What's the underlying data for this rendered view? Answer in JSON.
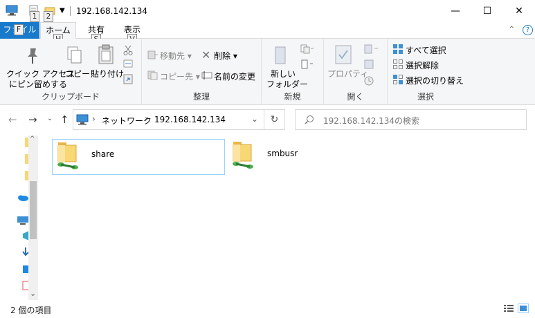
{
  "window": {
    "title": "192.168.142.134",
    "minimize": "—",
    "maximize": "☐",
    "close": "✕"
  },
  "keytips": {
    "qat1": "1",
    "qat2": "2",
    "file": "F",
    "home": "H",
    "share": "S",
    "view": "V"
  },
  "ribbon_tabs": {
    "file": "ファイル",
    "home": "ホーム",
    "share": "共有",
    "view": "表示"
  },
  "clipboard": {
    "pin_label_1": "クイック アクセス",
    "pin_label_2": "にピン留めする",
    "copy": "コピー",
    "paste": "貼り付け",
    "group": "クリップボード"
  },
  "organize": {
    "move_to": "移動先",
    "copy_to": "コピー先",
    "delete": "削除",
    "rename": "名前の変更",
    "group": "整理"
  },
  "new": {
    "new_folder_1": "新しい",
    "new_folder_2": "フォルダー",
    "group": "新規"
  },
  "open": {
    "properties": "プロパティ",
    "group": "開く"
  },
  "select": {
    "select_all": "すべて選択",
    "select_none": "選択解除",
    "invert": "選択の切り替え",
    "group": "選択"
  },
  "address": {
    "root": "ネットワーク",
    "current": "192.168.142.134"
  },
  "search": {
    "placeholder": "192.168.142.134の検索"
  },
  "items": [
    {
      "name": "share",
      "selected": true
    },
    {
      "name": "smbusr",
      "selected": false
    }
  ],
  "status": {
    "count": "2 個の項目"
  },
  "colors": {
    "accent": "#1979ca",
    "selection_border": "#99d1ff",
    "folder": "#f8d775"
  }
}
